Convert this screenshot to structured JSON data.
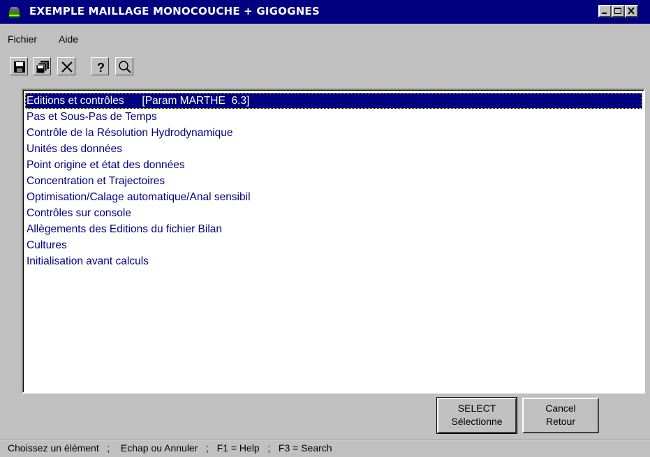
{
  "window": {
    "title": "EXEMPLE MAILLAGE MONOCOUCHE + GIGOGNES"
  },
  "menu": {
    "items": [
      "Fichier",
      "Aide"
    ]
  },
  "toolbar": {
    "buttons": [
      "save-icon",
      "save-all-icon",
      "delete-icon",
      "help-icon",
      "search-icon"
    ]
  },
  "list": {
    "items": [
      "Editions et contrôles      [Param MARTHE  6.3]",
      "Pas et Sous-Pas de Temps",
      "Contrôle de la Résolution Hydrodynamique",
      "Unités des données",
      "Point origine et état des données",
      "Concentration et Trajectoires",
      "Optimisation/Calage automatique/Anal sensibil",
      "Contrôles sur console",
      "Allègements des Editions du fichier Bilan",
      "Cultures",
      "Initialisation avant calculs"
    ],
    "selected_index": 0
  },
  "buttons": {
    "select_line1": "SELECT",
    "select_line2": "Sélectionne",
    "cancel_line1": "Cancel",
    "cancel_line2": "Retour"
  },
  "status": {
    "text": "Choissez un élément   ;    Echap ou Annuler   ;   F1 = Help   ;   F3 = Search"
  },
  "colors": {
    "titlebar": "#000080",
    "selection": "#000080",
    "item_text": "#000080",
    "face": "#c0c0c0"
  }
}
